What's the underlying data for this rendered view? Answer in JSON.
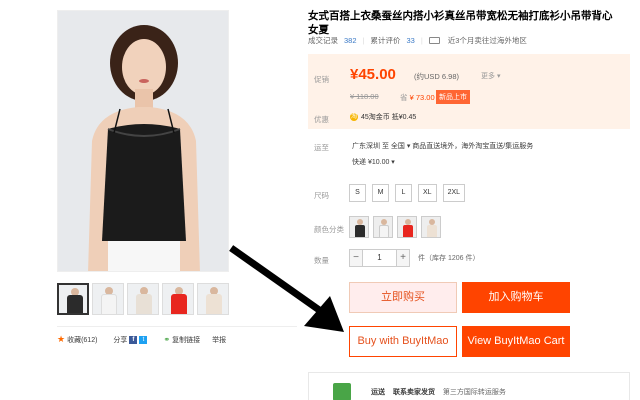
{
  "product": {
    "title": "女式百搭上衣桑蚕丝内搭小衫真丝吊带宽松无袖打底衫小吊带背心女夏",
    "stats": {
      "sales_label": "成交记录",
      "sales_value": "382",
      "reviews_label": "累计评价",
      "reviews_value": "33",
      "shipping_note": "近3个月卖往过海外地区"
    }
  },
  "price": {
    "label": "促销",
    "current": "¥45.00",
    "usd": "(约USD 6.98)",
    "more": "更多 ▾",
    "original": "¥ 118.00",
    "save": "省",
    "save_amount": "¥ 73.00",
    "new_tag": "新品上市",
    "promo_label": "优惠",
    "coin_text": "45淘金币 抵¥0.45"
  },
  "shipping": {
    "label": "运至",
    "line1": "广东深圳 至 全国 ▾   商品直送境外，海外淘宝直送/集运服务",
    "line2": "快递 ¥10.00 ▾"
  },
  "size": {
    "label": "尺码",
    "options": [
      "S",
      "M",
      "L",
      "XL",
      "2XL"
    ]
  },
  "color": {
    "label": "颜色分类",
    "swatches": [
      "#2b2b2b",
      "#f4f4f4",
      "#e8261f",
      "#ede1d4"
    ]
  },
  "quantity": {
    "label": "数量",
    "value": "1",
    "minus": "−",
    "plus": "+",
    "stock": "件（库存 1206 件）"
  },
  "buttons": {
    "buy_now": "立即购买",
    "add_cart": "加入购物车",
    "buy_bim": "Buy with BuyItMao",
    "view_bim": "View BuyItMao Cart"
  },
  "social": {
    "fav": "收藏(612)",
    "share": "分享",
    "copy_link": "复制链接",
    "report": "举报"
  },
  "promise": {
    "a": "运送",
    "b": "联系卖家发货",
    "c": "第三方国际转运服务"
  },
  "thumbs": [
    "#2b2b2b",
    "#f4f4f4",
    "#e8e0d6",
    "#e8261f",
    "#ede1d4"
  ]
}
